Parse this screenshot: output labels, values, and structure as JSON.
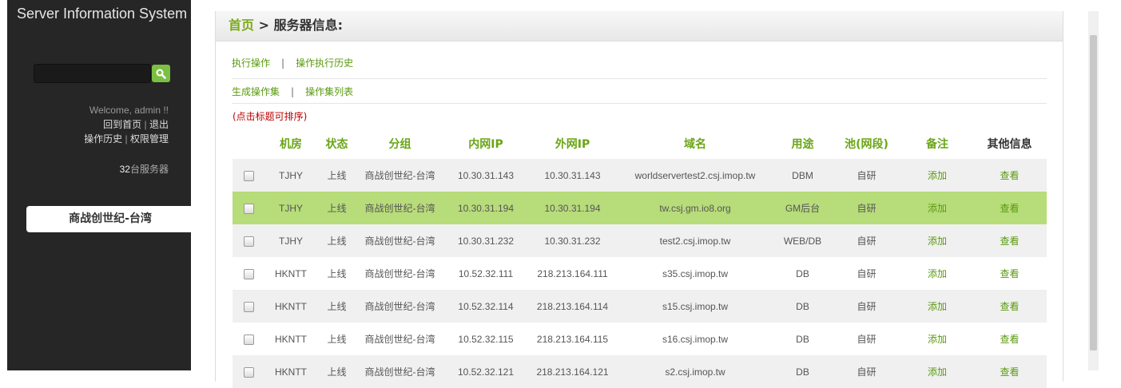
{
  "sidebar": {
    "system_title": "Server Information System",
    "welcome": "Welcome, admin !!",
    "home_link": "回到首页",
    "logout_link": "退出",
    "history_link": "操作历史",
    "permission_link": "权限管理",
    "server_count": "32",
    "server_count_unit": "台服务器",
    "group_tab": "商战创世纪-台湾"
  },
  "main": {
    "breadcrumb_home": "首页",
    "breadcrumb_sep": " > ",
    "breadcrumb_current": "服务器信息:",
    "exec_op": "执行操作",
    "exec_history": "操作执行历史",
    "gen_opset": "生成操作集",
    "opset_list": "操作集列表",
    "sep": "|",
    "sort_hint": "(点击标题可排序)"
  },
  "table": {
    "headers": [
      "",
      "机房",
      "状态",
      "分组",
      "内网IP",
      "外网IP",
      "域名",
      "用途",
      "池(网段)",
      "备注",
      "其他信息"
    ],
    "rows": [
      {
        "room": "TJHY",
        "status": "上线",
        "group": "商战创世纪-台湾",
        "lan": "10.30.31.143",
        "wan": "10.30.31.143",
        "domain": "worldservertest2.csj.imop.tw",
        "usage": "DBM",
        "pool": "自研",
        "note": "添加",
        "info": "查看"
      },
      {
        "room": "TJHY",
        "status": "上线",
        "group": "商战创世纪-台湾",
        "lan": "10.30.31.194",
        "wan": "10.30.31.194",
        "domain": "tw.csj.gm.io8.org",
        "usage": "GM后台",
        "pool": "自研",
        "note": "添加",
        "info": "查看"
      },
      {
        "room": "TJHY",
        "status": "上线",
        "group": "商战创世纪-台湾",
        "lan": "10.30.31.232",
        "wan": "10.30.31.232",
        "domain": "test2.csj.imop.tw",
        "usage": "WEB/DB",
        "pool": "自研",
        "note": "添加",
        "info": "查看"
      },
      {
        "room": "HKNTT",
        "status": "上线",
        "group": "商战创世纪-台湾",
        "lan": "10.52.32.111",
        "wan": "218.213.164.111",
        "domain": "s35.csj.imop.tw",
        "usage": "DB",
        "pool": "自研",
        "note": "添加",
        "info": "查看"
      },
      {
        "room": "HKNTT",
        "status": "上线",
        "group": "商战创世纪-台湾",
        "lan": "10.52.32.114",
        "wan": "218.213.164.114",
        "domain": "s15.csj.imop.tw",
        "usage": "DB",
        "pool": "自研",
        "note": "添加",
        "info": "查看"
      },
      {
        "room": "HKNTT",
        "status": "上线",
        "group": "商战创世纪-台湾",
        "lan": "10.52.32.115",
        "wan": "218.213.164.115",
        "domain": "s16.csj.imop.tw",
        "usage": "DB",
        "pool": "自研",
        "note": "添加",
        "info": "查看"
      },
      {
        "room": "HKNTT",
        "status": "上线",
        "group": "商战创世纪-台湾",
        "lan": "10.52.32.121",
        "wan": "218.213.164.121",
        "domain": "s2.csj.imop.tw",
        "usage": "DB",
        "pool": "自研",
        "note": "添加",
        "info": "查看"
      }
    ]
  },
  "colors": {
    "accent": "#6aa515",
    "highlight_row": "#b7dc7a",
    "sidebar_bg": "#262626"
  }
}
